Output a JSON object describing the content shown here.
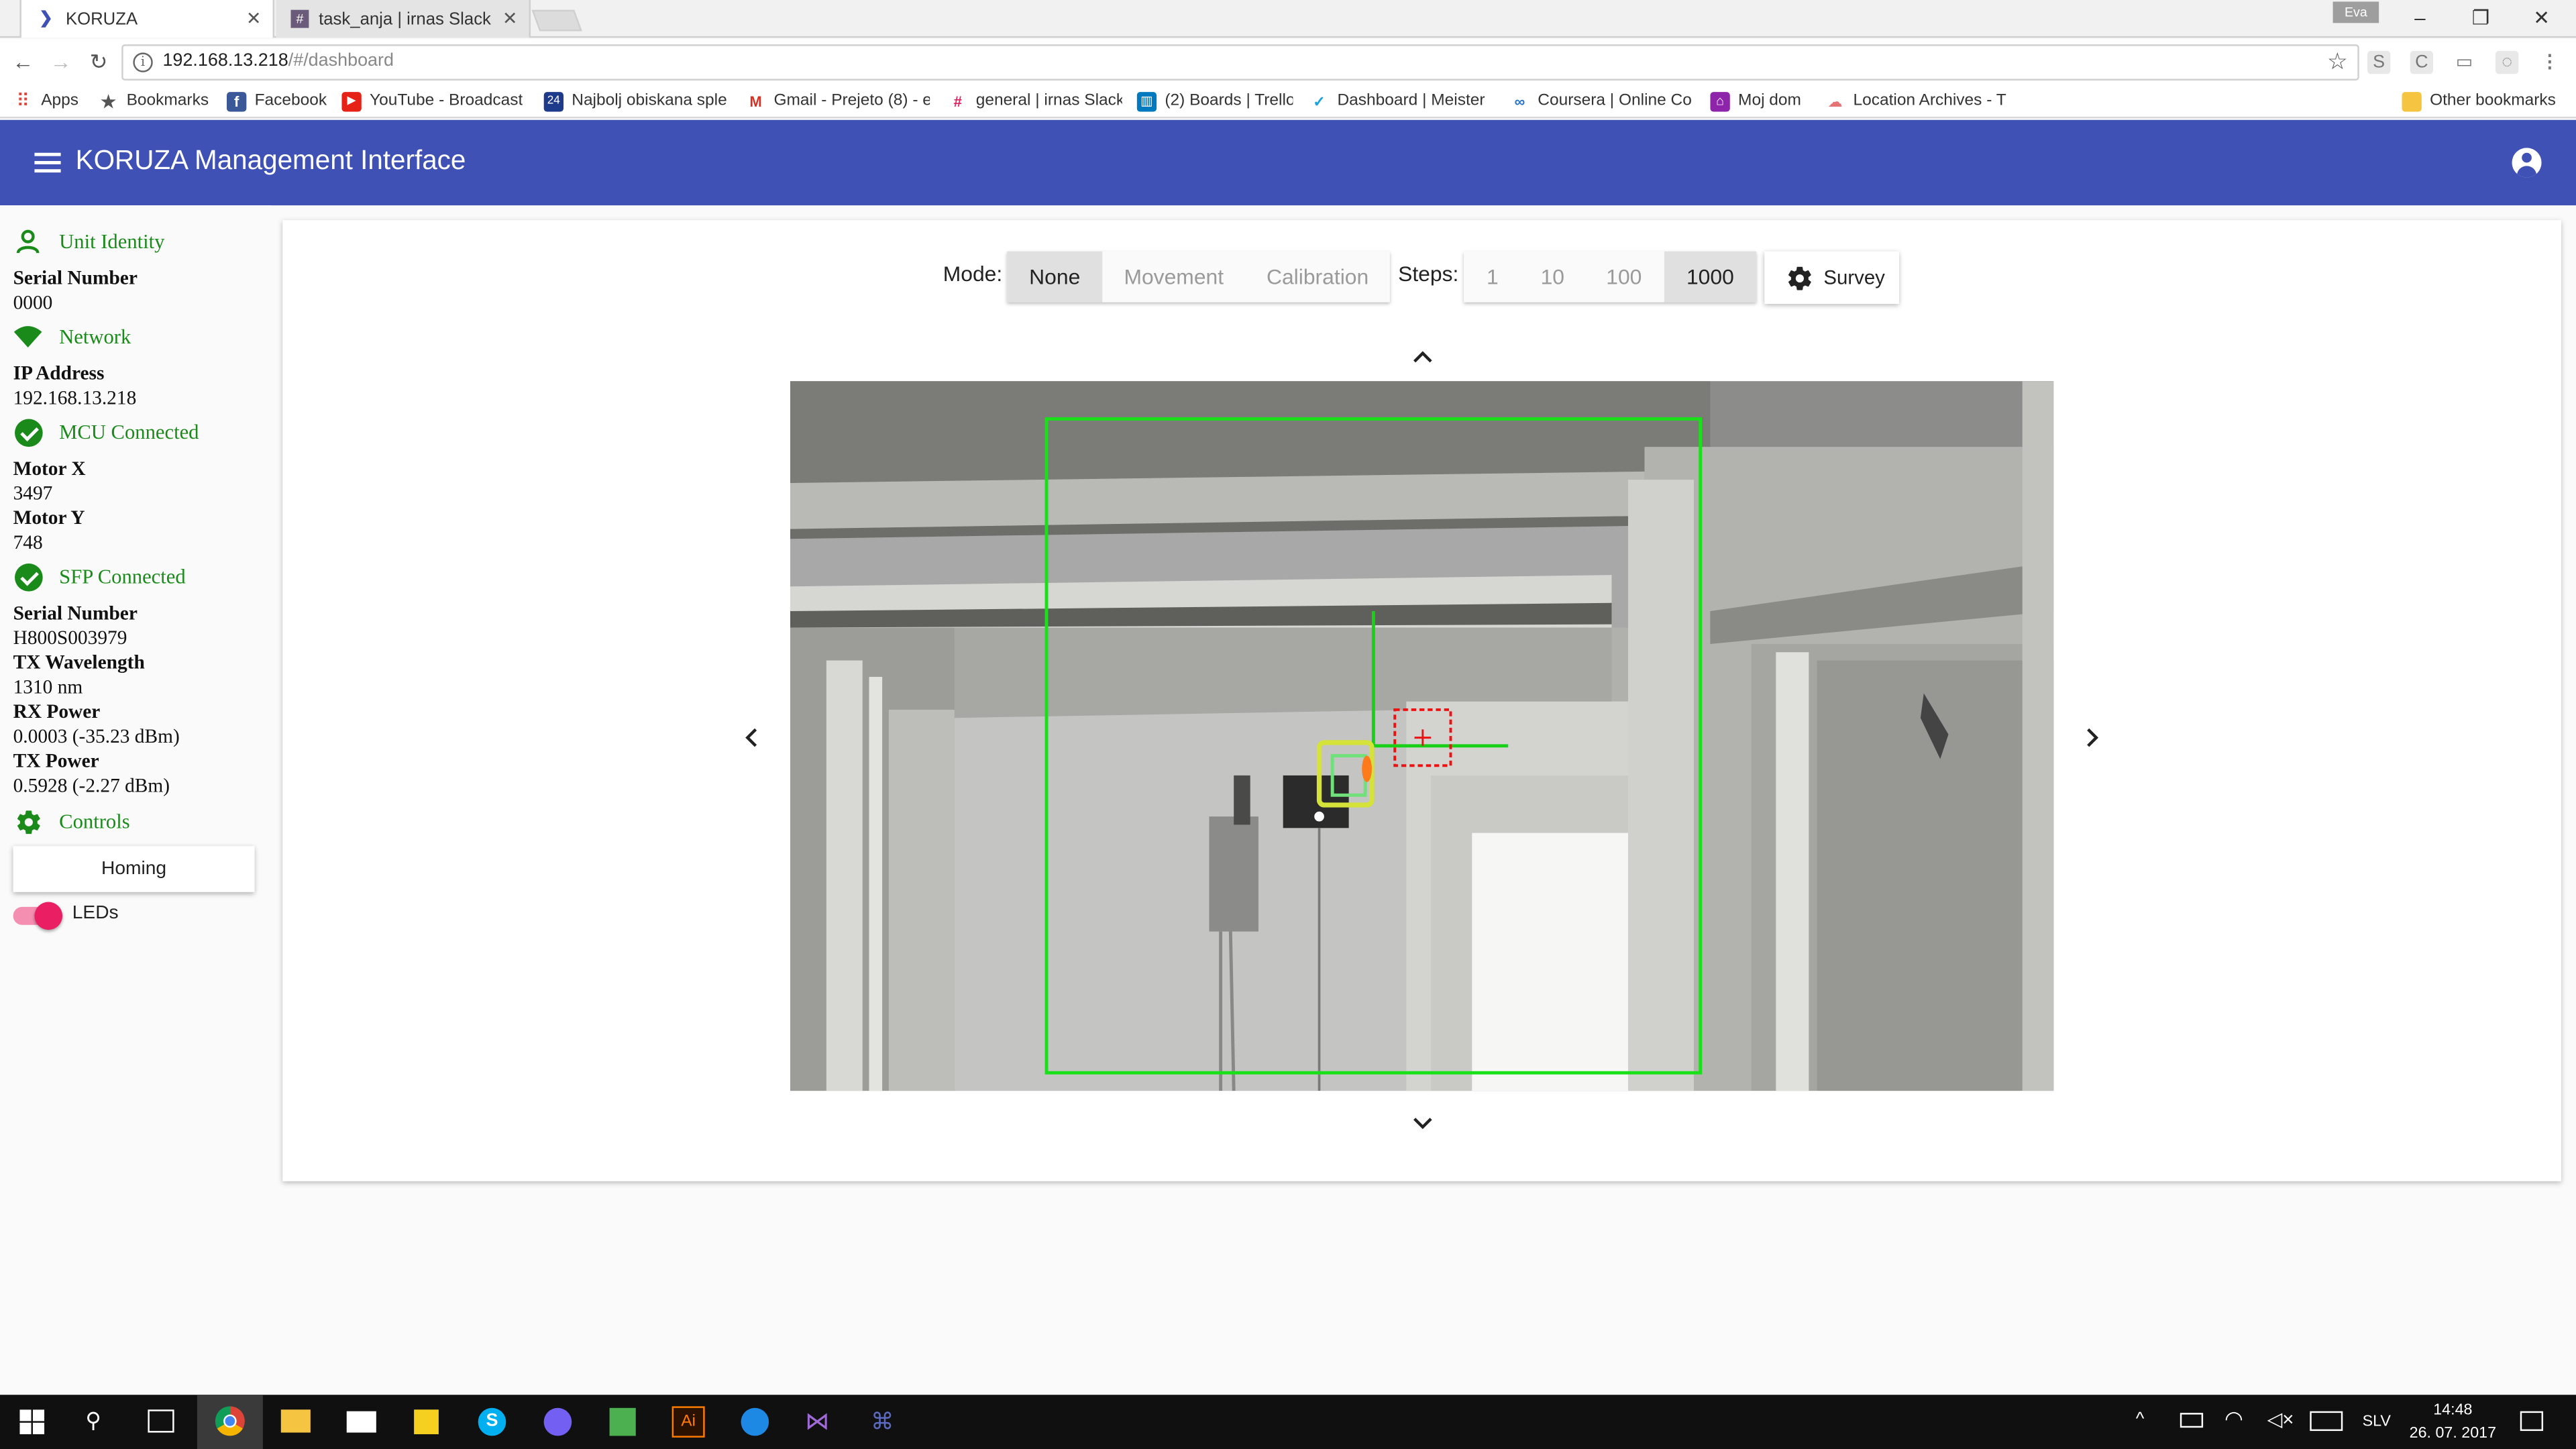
{
  "browser": {
    "tabs": [
      {
        "title": "KORUZA",
        "icon": "chevron-right-icon"
      },
      {
        "title": "task_anja | irnas Slack",
        "icon": "slack-hash-icon"
      }
    ],
    "profile_name": "Eva",
    "url_host": "192.168.13.218",
    "url_path": "/#/dashboard",
    "bookmarks": [
      {
        "label": "Apps",
        "icon": "apps-grid-icon",
        "color": "#e0463a"
      },
      {
        "label": "Bookmarks",
        "icon": "star-icon",
        "color": "#555555"
      },
      {
        "label": "Facebook",
        "icon": "facebook-icon",
        "color": "#3b5998"
      },
      {
        "label": "YouTube - Broadcast",
        "icon": "youtube-icon",
        "color": "#e62117"
      },
      {
        "label": "Najbolj obiskana sple",
        "icon": "24ur-icon",
        "color": "#1e3a8a"
      },
      {
        "label": "Gmail - Prejeto (8) - e",
        "icon": "gmail-icon",
        "color": "#d93025"
      },
      {
        "label": "general | irnas Slack",
        "icon": "slack-icon",
        "color": "#4a154b"
      },
      {
        "label": "(2) Boards | Trello",
        "icon": "trello-icon",
        "color": "#0079bf"
      },
      {
        "label": "Dashboard | Meister",
        "icon": "meistertask-icon",
        "color": "#1ba1e2"
      },
      {
        "label": "Coursera | Online Co",
        "icon": "coursera-icon",
        "color": "#2a73cc"
      },
      {
        "label": "Moj dom",
        "icon": "home-icon",
        "color": "#8e24aa"
      },
      {
        "label": "Location Archives - T",
        "icon": "location-icon",
        "color": "#e57373"
      }
    ],
    "other_bookmarks": "Other bookmarks"
  },
  "app": {
    "title": "KORUZA Management Interface",
    "header_color": "#3f51b5",
    "accent_green": "#1a8a1a"
  },
  "sidebar": {
    "unit_identity": {
      "heading": "Unit Identity",
      "serial_label": "Serial Number",
      "serial_value": "0000"
    },
    "network": {
      "heading": "Network",
      "ip_label": "IP Address",
      "ip_value": "192.168.13.218"
    },
    "mcu": {
      "heading": "MCU Connected",
      "motor_x_label": "Motor X",
      "motor_x_value": "3497",
      "motor_y_label": "Motor Y",
      "motor_y_value": "748"
    },
    "sfp": {
      "heading": "SFP Connected",
      "serial_label": "Serial Number",
      "serial_value": "H800S003979",
      "tx_wavelength_label": "TX Wavelength",
      "tx_wavelength_value": "1310 nm",
      "rx_power_label": "RX Power",
      "rx_power_value": "0.0003 (-35.23 dBm)",
      "tx_power_label": "TX Power",
      "tx_power_value": "0.5928 (-2.27 dBm)"
    },
    "controls": {
      "heading": "Controls",
      "homing_label": "Homing",
      "leds_label": "LEDs",
      "leds_on": true
    }
  },
  "toolbar": {
    "mode_label": "Mode:",
    "modes": [
      "None",
      "Movement",
      "Calibration"
    ],
    "selected_mode": "None",
    "steps_label": "Steps:",
    "steps": [
      "1",
      "10",
      "100",
      "1000"
    ],
    "selected_step": "1000",
    "survey_label": "Survey"
  },
  "taskbar": {
    "language": "SLV",
    "time": "14:48",
    "date": "26. 07. 2017"
  }
}
